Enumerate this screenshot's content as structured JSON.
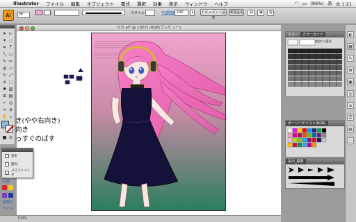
{
  "menubar": {
    "apple_glyph": "",
    "app_name": "Illustrator",
    "items": [
      "ファイル",
      "編集",
      "オブジェクト",
      "書式",
      "選択",
      "効果",
      "表示",
      "ウィンドウ",
      "ヘルプ"
    ],
    "battery": "(96%)",
    "clock": "水 1:21"
  },
  "controlbar": {
    "logo": "Ai",
    "style_label": "スタイル",
    "opacity_label": "不透明度",
    "opacity_value": "100",
    "document_button": "ドキュメント設定",
    "env_button": "環境設定"
  },
  "document": {
    "title": "ルカ.ai* @ 100% (RGB/プレビュー)",
    "zoom": "100%"
  },
  "panels": {
    "color_tabs": [
      "カラー",
      "カラーガイド"
    ],
    "color_guide_label": "色合い/濃淡",
    "swatch_title": "ボーリーテイスト(RGB)",
    "brush_tab": "矢印_標準"
  },
  "popup": {
    "items": [
      "変形",
      "整列",
      "パスファインダ"
    ]
  },
  "ghost_text": {
    "line1": "き(やや右向き)",
    "line2": "向き",
    "line3": "っすぐのばす"
  },
  "left_labels": {
    "label1": "白黒",
    "label2": "標準ビ",
    "label3": "サイズ"
  },
  "colors": {
    "canvas_top": "#f1a3cd",
    "canvas_bottom": "#2a7f5c",
    "hair": "#ef76bd",
    "dress": "#14123a",
    "app_orange": "#f29b1c"
  }
}
